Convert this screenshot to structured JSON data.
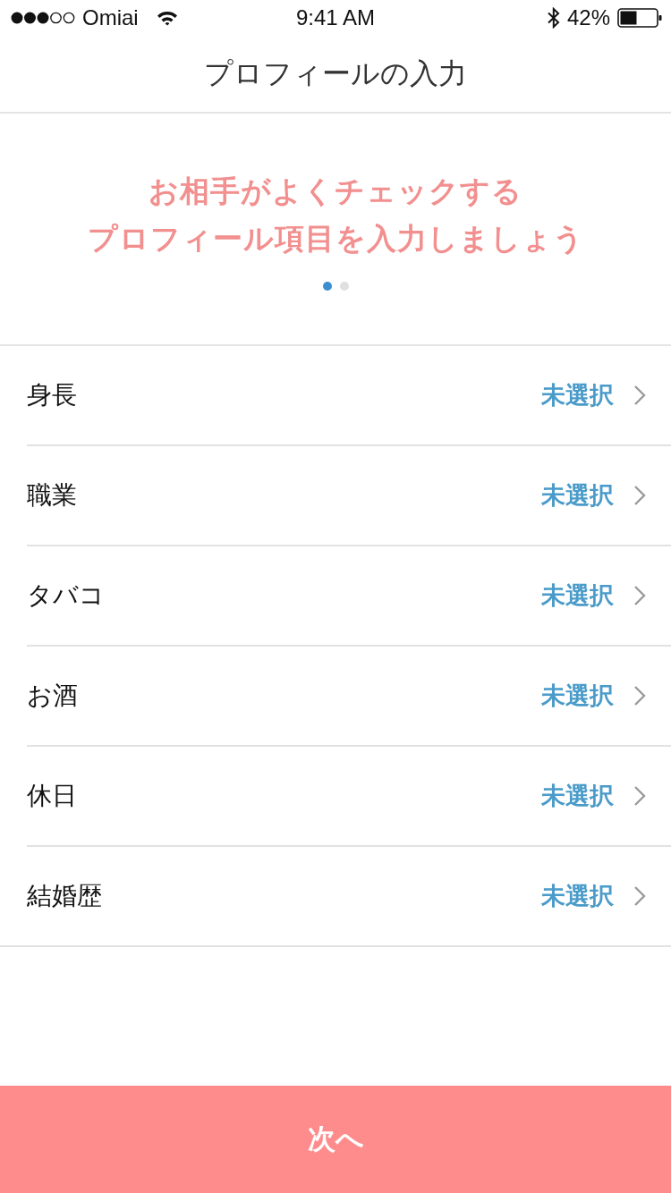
{
  "status_bar": {
    "carrier": "Omiai",
    "time": "9:41 AM",
    "battery": "42%"
  },
  "nav_bar": {
    "title": "プロフィールの入力"
  },
  "banner": {
    "headline_lines": [
      "お相手がよくチェックする",
      "プロフィール項目を入力しましょう"
    ],
    "pager": [
      {
        "selected": true
      },
      {
        "selected": false
      }
    ]
  },
  "profile_items": [
    {
      "label": "身長",
      "value": "未選択"
    },
    {
      "label": "職業",
      "value": "未選択"
    },
    {
      "label": "タバコ",
      "value": "未選択"
    },
    {
      "label": "お酒",
      "value": "未選択"
    },
    {
      "label": "休日",
      "value": "未選択"
    },
    {
      "label": "結婚歴",
      "value": "未選択"
    }
  ],
  "next_button": {
    "label": "次へ"
  }
}
